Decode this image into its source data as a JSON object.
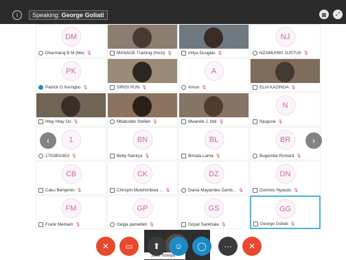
{
  "speaking": {
    "prefix": "Speaking:",
    "name": "George Goliati"
  },
  "top_icons": {
    "info": "info-icon",
    "layout": "grid-layout-icon",
    "minimize": "exit-fullscreen-icon"
  },
  "participants": [
    {
      "initials": "DM",
      "name": "Dharmaraj B M (Me)",
      "video": false
    },
    {
      "initials": "",
      "name": "MANAGE Training (Host)",
      "video": true
    },
    {
      "initials": "",
      "name": "milya Douglas",
      "video": true
    },
    {
      "initials": "NJ",
      "name": "NZAMUHIKI JUSTUS",
      "video": false
    },
    {
      "initials": "PK",
      "name": "Patrick G Kerngbo",
      "video": false
    },
    {
      "initials": "",
      "name": "SIRISI PUN",
      "video": true
    },
    {
      "initials": "A",
      "name": "Amon",
      "video": false
    },
    {
      "initials": "",
      "name": "ELIA KAZINGA",
      "video": true
    },
    {
      "initials": "",
      "name": "Htay Htay Oo",
      "video": true
    },
    {
      "initials": "",
      "name": "Mbatudde Stellah",
      "video": true
    },
    {
      "initials": "",
      "name": "Mwanidi J. Iddi",
      "video": true
    },
    {
      "initials": "N",
      "name": "Njuguna",
      "video": false
    },
    {
      "initials": "1",
      "name": "1702801653",
      "video": false
    },
    {
      "initials": "BN",
      "name": "Betty Nankya",
      "video": false
    },
    {
      "initials": "BL",
      "name": "Bimala Lama",
      "video": false
    },
    {
      "initials": "BR",
      "name": "Bugembe Richard",
      "video": false
    },
    {
      "initials": "CB",
      "name": "Caku Benjamin",
      "video": false
    },
    {
      "initials": "CK",
      "name": "Chrispin Mutehimbwa ...",
      "video": false
    },
    {
      "initials": "DZ",
      "name": "Diana Mayamiko Zamb...",
      "video": false
    },
    {
      "initials": "DN",
      "name": "Dominic Nyaudu",
      "video": false
    },
    {
      "initials": "FM",
      "name": "Frank Memam",
      "video": false
    },
    {
      "initials": "GP",
      "name": "Geiga pamellah",
      "video": false
    },
    {
      "initials": "GS",
      "name": "Gopal Sankhala",
      "video": false
    },
    {
      "initials": "GG",
      "name": "George Goliati",
      "video": false
    }
  ],
  "self_view": {
    "name": "Jane Nzeiya"
  },
  "controls": [
    {
      "icon": "mute-microphone-icon",
      "color": "#e9492e"
    },
    {
      "icon": "video-off-icon",
      "color": "#e9492e"
    },
    {
      "icon": "share-screen-icon",
      "color": "#3a3a3a"
    },
    {
      "icon": "participants-icon",
      "color": "#1b8ac6"
    },
    {
      "icon": "chat-icon",
      "color": "#1b8ac6"
    },
    {
      "icon": "more-options-icon",
      "color": "#3a3a3a"
    },
    {
      "icon": "leave-meeting-icon",
      "color": "#e9492e"
    }
  ]
}
